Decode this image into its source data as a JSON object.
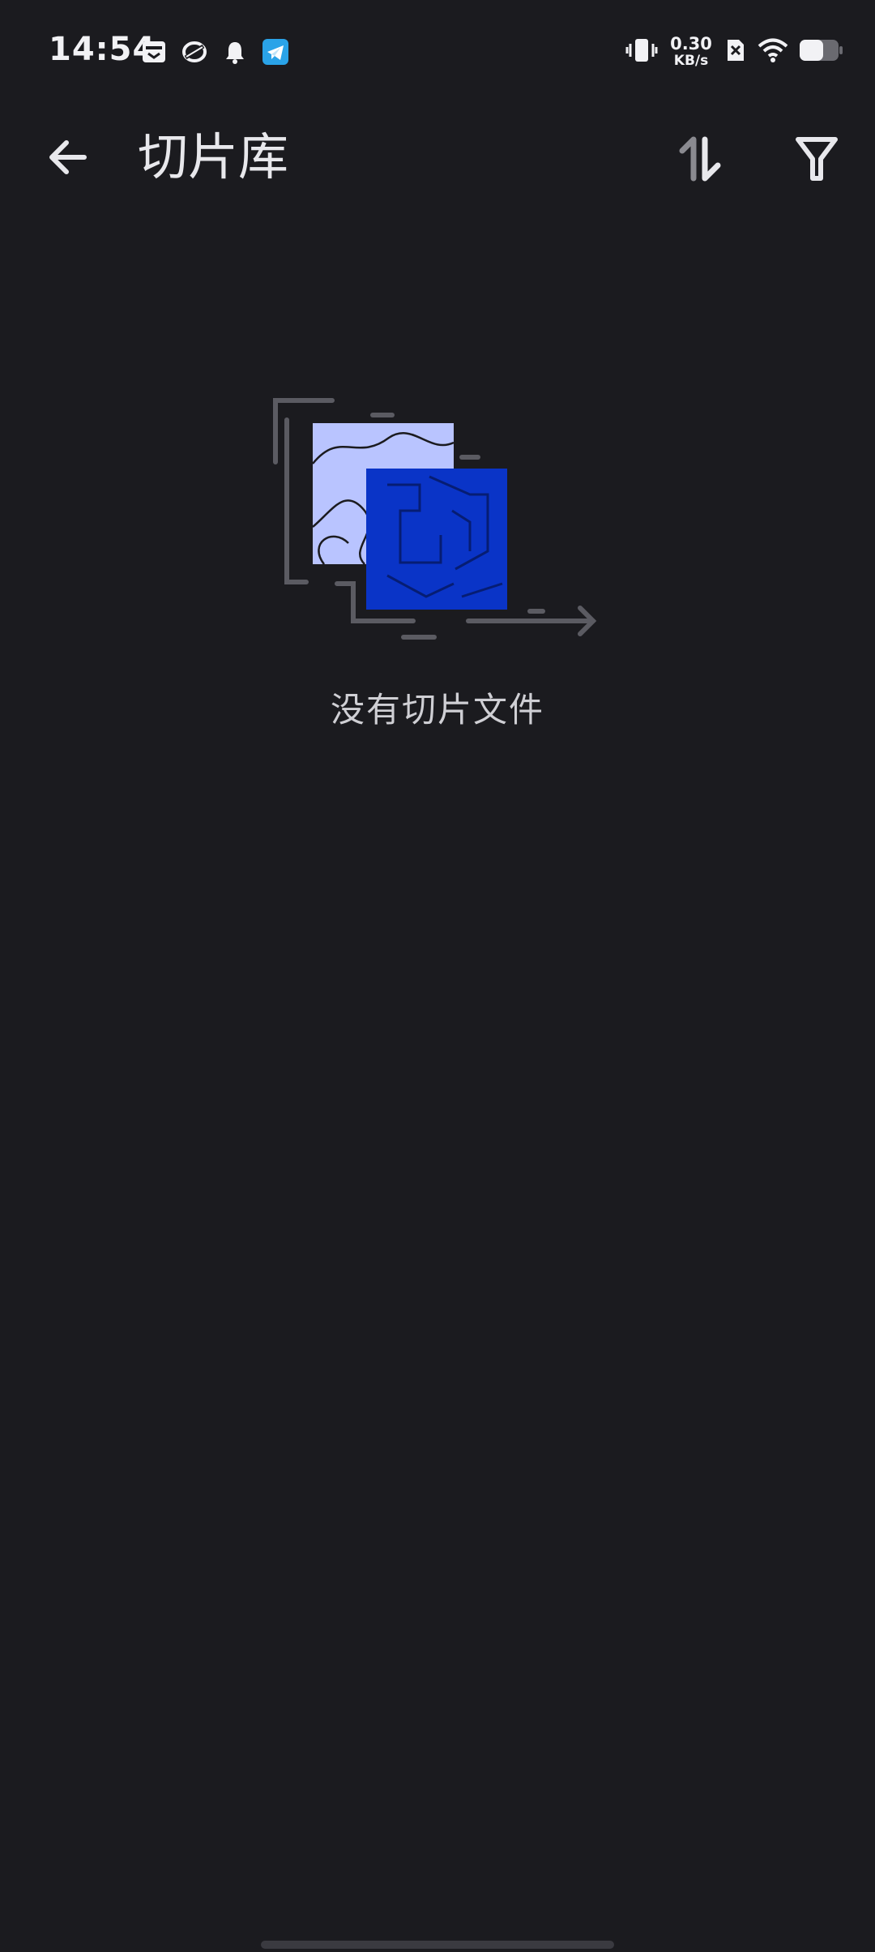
{
  "status_bar": {
    "time": "14:54",
    "net_speed_value": "0.30",
    "net_speed_unit": "KB/s",
    "left_icons": [
      "calendar-icon",
      "app-ring-icon",
      "bell-icon",
      "telegram-icon"
    ],
    "right_icons": [
      "vibrate-icon",
      "sim-off-icon",
      "wifi-icon",
      "battery-icon"
    ],
    "battery_level": 0.6
  },
  "app_bar": {
    "title": "切片库",
    "back_icon": "arrow-left-icon",
    "sort_icon": "sort-icon",
    "filter_icon": "filter-icon"
  },
  "empty_state": {
    "message": "没有切片文件",
    "colors": {
      "light_tile": "#b9c4ff",
      "dark_tile": "#0a34c7",
      "frame": "#5b5b62"
    }
  }
}
